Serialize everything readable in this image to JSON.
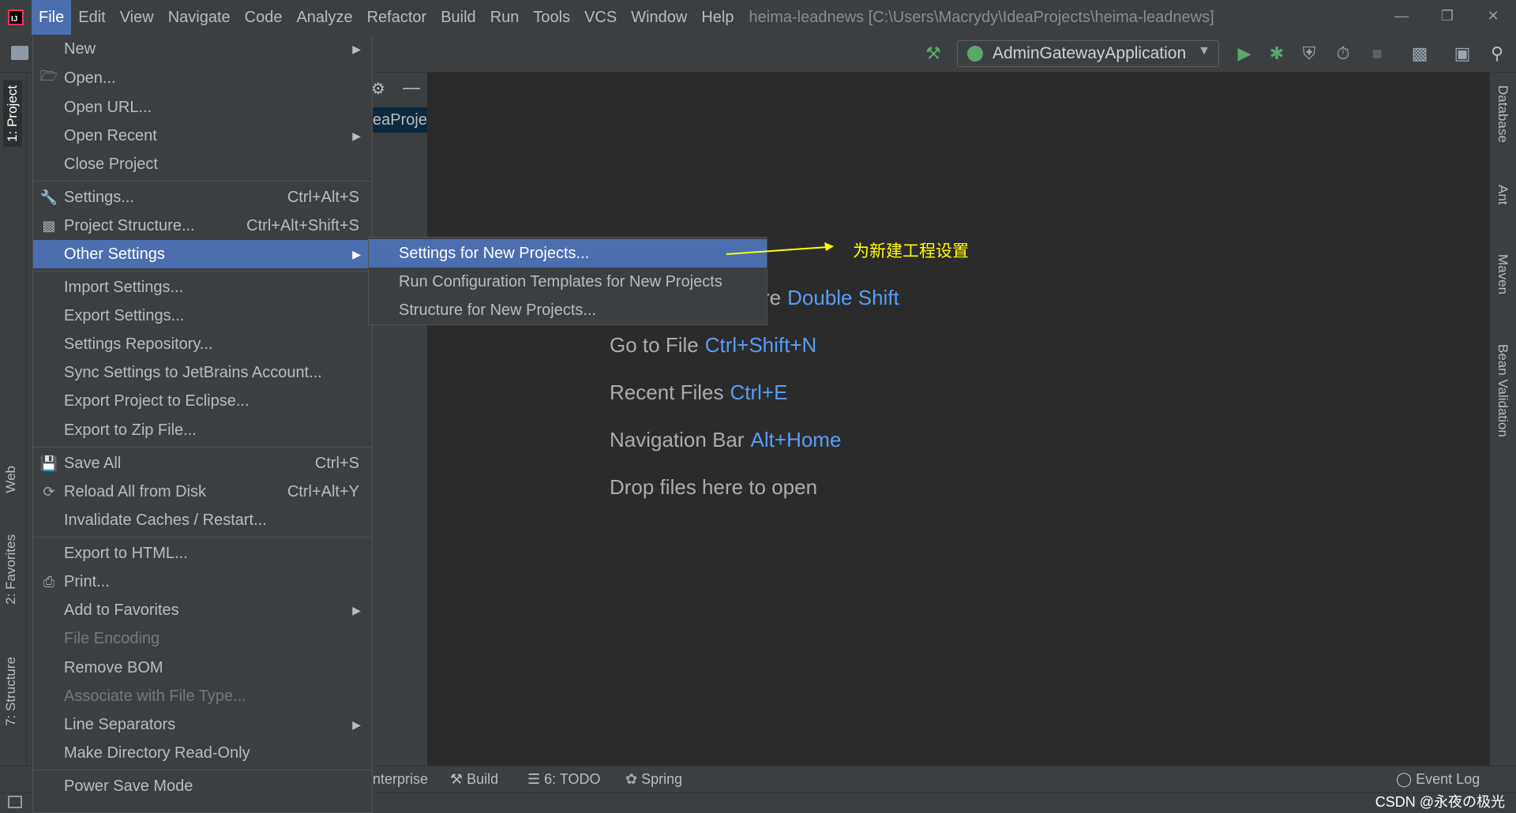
{
  "menubar": {
    "items": [
      "File",
      "Edit",
      "View",
      "Navigate",
      "Code",
      "Analyze",
      "Refactor",
      "Build",
      "Run",
      "Tools",
      "VCS",
      "Window",
      "Help"
    ],
    "window_title": "heima-leadnews [C:\\Users\\Macrydy\\IdeaProjects\\heima-leadnews]"
  },
  "toolbar": {
    "run_config": "AdminGatewayApplication"
  },
  "left_stripe": {
    "project": "1: Project",
    "web": "Web",
    "favorites": "2: Favorites",
    "structure": "7: Structure"
  },
  "right_stripe": {
    "database": "Database",
    "ant": "Ant",
    "maven": "Maven",
    "bean_validation": "Bean Validation"
  },
  "project_pane": {
    "row_text": "eaProje"
  },
  "file_menu": {
    "new": "New",
    "open": "Open...",
    "open_url": "Open URL...",
    "open_recent": "Open Recent",
    "close_project": "Close Project",
    "settings": "Settings...",
    "settings_sc": "Ctrl+Alt+S",
    "project_structure": "Project Structure...",
    "project_structure_sc": "Ctrl+Alt+Shift+S",
    "other_settings": "Other Settings",
    "import_settings": "Import Settings...",
    "export_settings": "Export Settings...",
    "settings_repository": "Settings Repository...",
    "sync_settings": "Sync Settings to JetBrains Account...",
    "export_eclipse": "Export Project to Eclipse...",
    "export_zip": "Export to Zip File...",
    "save_all": "Save All",
    "save_all_sc": "Ctrl+S",
    "reload": "Reload All from Disk",
    "reload_sc": "Ctrl+Alt+Y",
    "invalidate": "Invalidate Caches / Restart...",
    "export_html": "Export to HTML...",
    "print": "Print...",
    "add_favorites": "Add to Favorites",
    "file_encoding": "File Encoding",
    "remove_bom": "Remove BOM",
    "associate": "Associate with File Type...",
    "line_separators": "Line Separators",
    "make_readonly": "Make Directory Read-Only",
    "power_save": "Power Save Mode"
  },
  "submenu": {
    "items": [
      "Settings for New Projects...",
      "Run Configuration Templates for New Projects",
      "Structure for New Projects..."
    ]
  },
  "annotation": {
    "text": "为新建工程设置",
    "color": "#ffff00"
  },
  "editor_hints": {
    "search_everywhere_tail": "re",
    "search_everywhere_key": "Double Shift",
    "goto_file": "Go to File",
    "goto_file_key": "Ctrl+Shift+N",
    "recent_files": "Recent Files",
    "recent_files_key": "Ctrl+E",
    "nav_bar": "Navigation Bar",
    "nav_bar_key": "Alt+Home",
    "drop_files": "Drop files here to open"
  },
  "bottom_bar": {
    "enterprise_tail": "nterprise",
    "build": "Build",
    "todo": "6: TODO",
    "spring": "Spring",
    "event_log": "Event Log"
  },
  "watermark": "CSDN @永夜の极光",
  "colors": {
    "accent": "#4b6eaf",
    "link": "#589df6",
    "panel": "#3c3f41",
    "editor_bg": "#2b2b2b"
  }
}
